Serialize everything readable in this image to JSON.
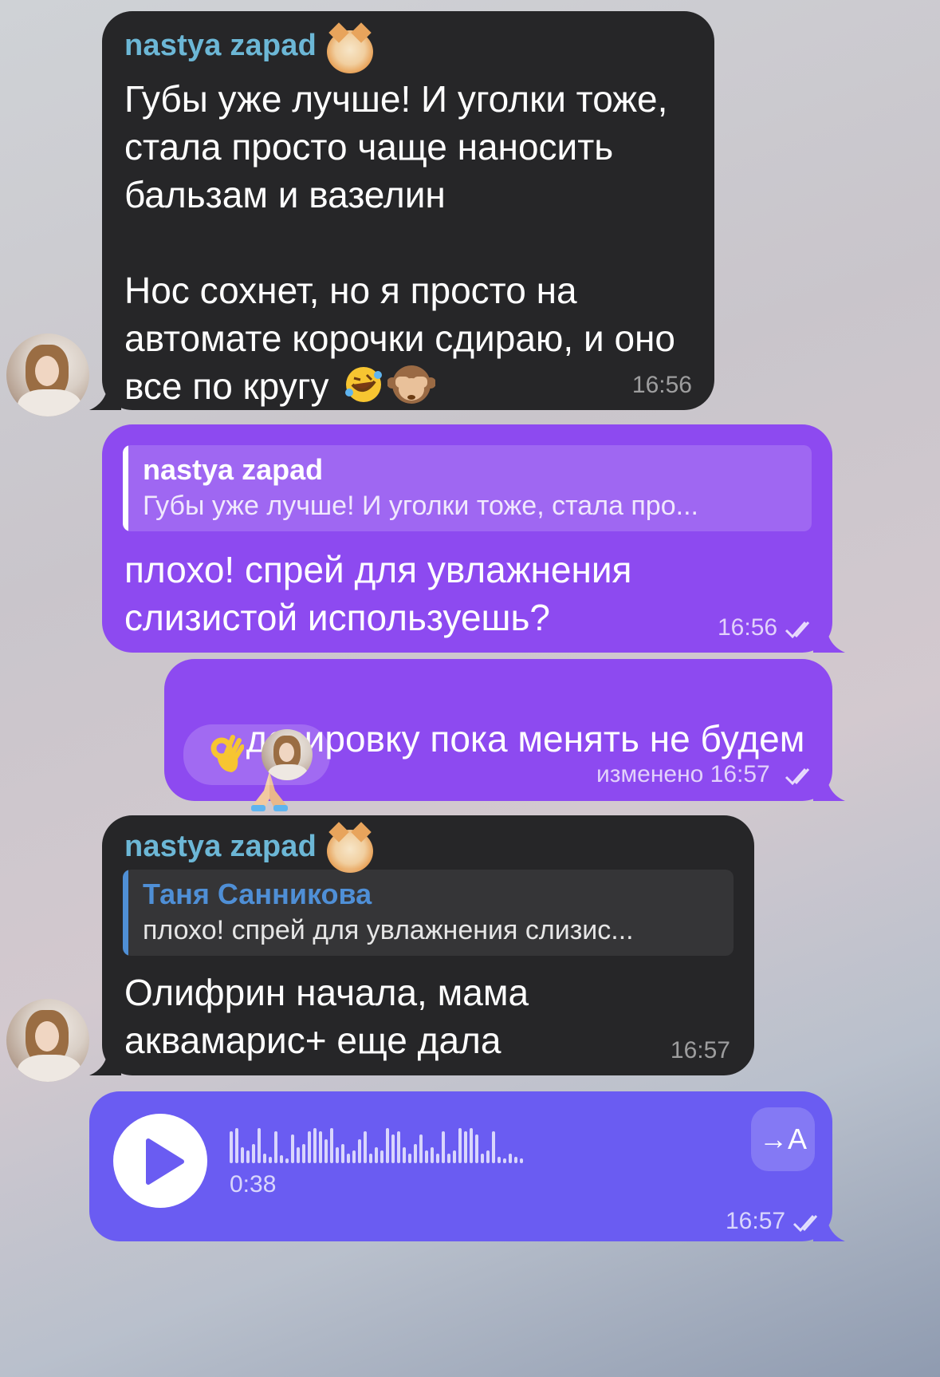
{
  "messages": {
    "m1": {
      "sender": "nastya zapad",
      "text": "Губы уже лучше! И уголки тоже,\nстала просто чаще наносить\nбальзам и вазелин\n\nНос сохнет, но я просто на\nавтомате корочки сдираю, и оно\nвсе по кругу",
      "time": "16:56"
    },
    "m2": {
      "reply_name": "nastya zapad",
      "reply_text": "Губы уже лучше! И уголки тоже, стала про...",
      "text": "плохо! спрей для увлажнения\nслизистой используешь?",
      "time": "16:56"
    },
    "m3": {
      "text": "дозировку пока менять не будем",
      "edited_time": "изменено 16:57"
    },
    "m4": {
      "sender": "nastya zapad",
      "reply_name": "Таня Санникова",
      "reply_text": "плохо! спрей для увлажнения слизис...",
      "text": "Олифрин начала, мама\nаквамарис+ еще дала",
      "time": "16:57"
    },
    "m5": {
      "duration": "0:38",
      "transcribe_label": "→A",
      "time": "16:57"
    }
  },
  "colors": {
    "incoming": "#262628",
    "outgoing": "#8d4af0",
    "voice": "#6a5cf2",
    "sender_name": "#6cb7d6",
    "reply_name_out": "#ffffff",
    "reply_name_in": "#4f8fd6"
  },
  "icons": [
    "cat-sticker-icon",
    "rofl-emoji-icon",
    "see-no-evil-monkey-icon",
    "pray-hands-icon",
    "ok-hand-icon",
    "play-icon",
    "double-check-icon",
    "transcribe-icon"
  ]
}
